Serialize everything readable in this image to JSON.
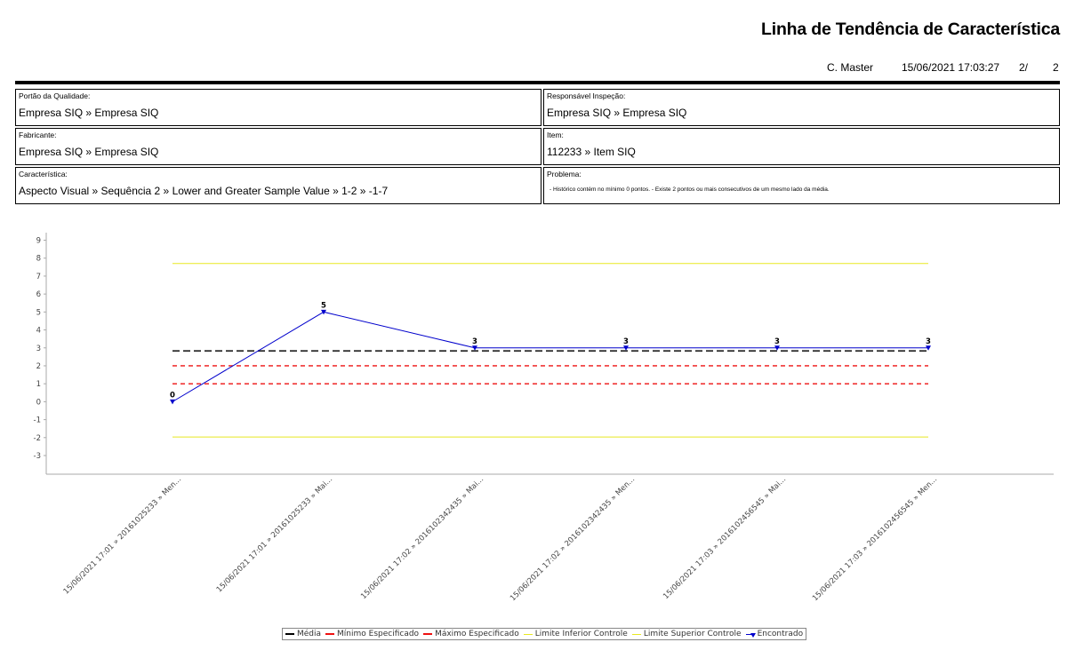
{
  "header": {
    "title": "Linha de Tendência de Característica",
    "user": "C. Master",
    "datetime": "15/06/2021 17:03:27",
    "page": "2/",
    "total_pages": "2"
  },
  "info": {
    "quality_gate": {
      "label": "Portão da Qualidade:",
      "value": "Empresa SIQ » Empresa SIQ"
    },
    "inspection_owner": {
      "label": "Responsável Inspeção:",
      "value": "Empresa SIQ » Empresa SIQ"
    },
    "manufacturer": {
      "label": "Fabricante:",
      "value": "Empresa SIQ » Empresa SIQ"
    },
    "item": {
      "label": "Item:",
      "value": "112233 » Item SIQ"
    },
    "characteristic": {
      "label": "Característica:",
      "value": "Aspecto Visual » Sequência 2 » Lower and Greater Sample Value » 1-2 » -1-7"
    },
    "problem": {
      "label": "Problema:",
      "value": " - Histórico contém no mínimo 0 pontos. - Existe 2 pontos ou mais consecutivos de um mesmo lado da média."
    }
  },
  "chart_data": {
    "type": "line",
    "categories": [
      "15/06/2021 17:01 » 20161025233 » Men...",
      "15/06/2021 17:01 » 20161025233 » Mai...",
      "15/06/2021 17:02 » 2016102342435 » Mai...",
      "15/06/2021 17:02 » 2016102342435 » Men...",
      "15/06/2021 17:03 » 2016102456545 » Mai...",
      "15/06/2021 17:03 » 2016102456545 » Men..."
    ],
    "ylim": [
      -3,
      9
    ],
    "yticks": [
      -3,
      -2,
      -1,
      0,
      1,
      2,
      3,
      4,
      5,
      6,
      7,
      8,
      9
    ],
    "series": [
      {
        "name": "Encontrado",
        "values": [
          0,
          5,
          3,
          3,
          3,
          3
        ],
        "color": "#0000cc"
      }
    ],
    "reference_lines": [
      {
        "name": "Média",
        "value": 2.83,
        "color": "#333333",
        "style": "dashed"
      },
      {
        "name": "Mínimo Especificado",
        "value": 1,
        "color": "#ee1111",
        "style": "dashed"
      },
      {
        "name": "Máximo Especificado",
        "value": 2,
        "color": "#ee1111",
        "style": "dashed"
      },
      {
        "name": "Limite Inferior Controle",
        "value": -1.97,
        "color": "#e8e820",
        "style": "solid"
      },
      {
        "name": "Limite Superior Controle",
        "value": 7.7,
        "color": "#e8e820",
        "style": "solid"
      }
    ],
    "legend": [
      {
        "label": "Média",
        "color": "#000000",
        "style": "dashed"
      },
      {
        "label": "Mínimo Especificado",
        "color": "#ee1111",
        "style": "dashed"
      },
      {
        "label": "Máximo Especificado",
        "color": "#ee1111",
        "style": "dashed"
      },
      {
        "label": "Limite Inferior Controle",
        "color": "#e8e820",
        "style": "solid"
      },
      {
        "label": "Limite Superior Controle",
        "color": "#e8e820",
        "style": "solid"
      },
      {
        "label": "Encontrado",
        "color": "#0000cc",
        "style": "marker"
      }
    ],
    "legend_position": "bottom",
    "grid": false
  }
}
